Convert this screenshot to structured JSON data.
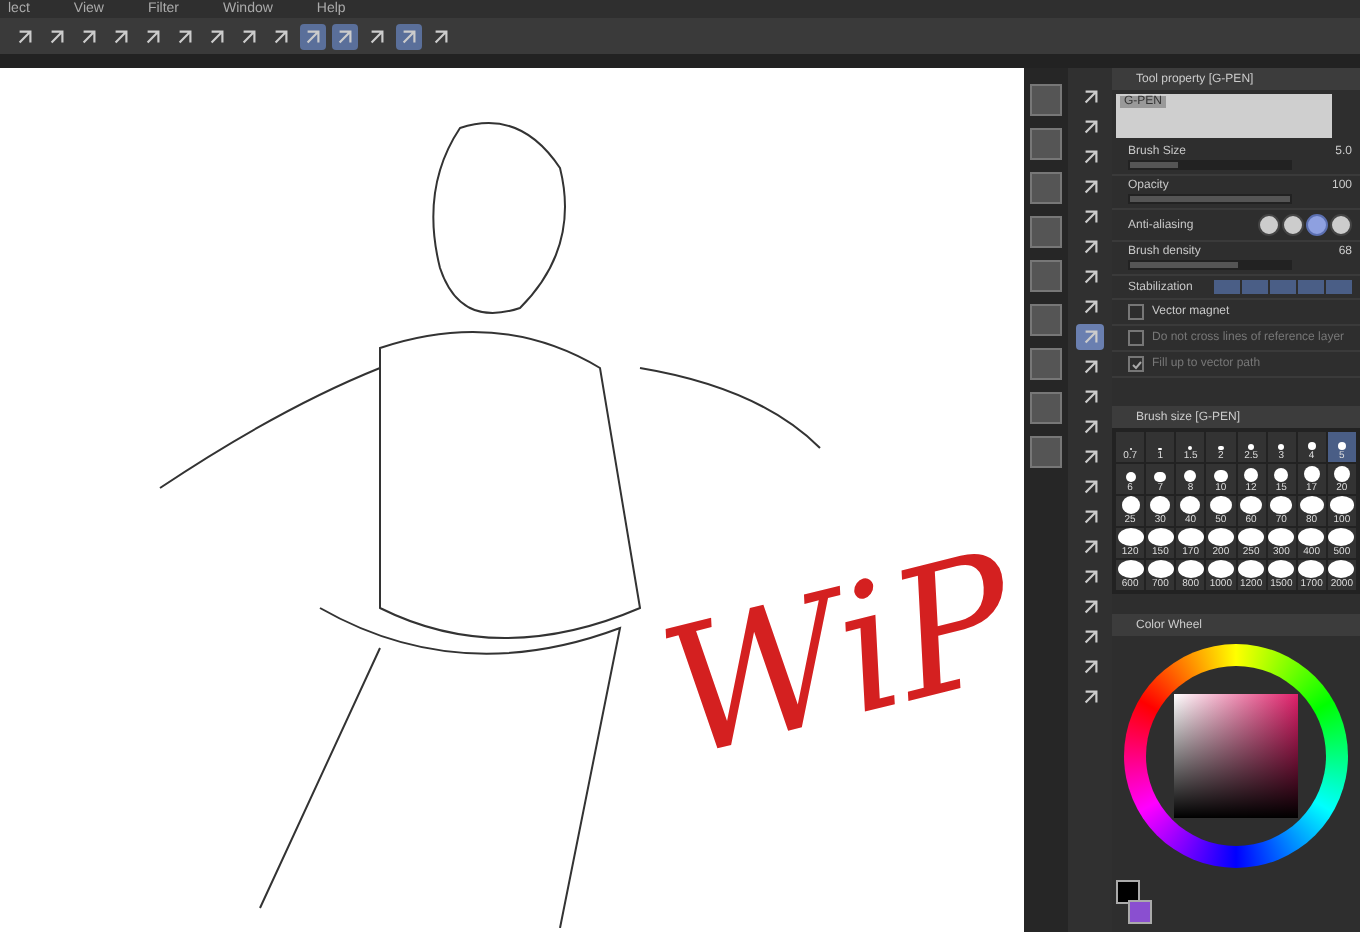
{
  "menu": [
    "lect",
    "View",
    "Filter",
    "Window",
    "Help"
  ],
  "toolbar": [
    {
      "selected": false
    },
    {
      "selected": false
    },
    {
      "selected": false
    },
    {
      "selected": false
    },
    {
      "selected": false
    },
    {
      "selected": false
    },
    {
      "selected": false
    },
    {
      "selected": false
    },
    {
      "selected": false
    },
    {
      "selected": true
    },
    {
      "selected": true
    },
    {
      "selected": false
    },
    {
      "selected": true
    },
    {
      "selected": false
    }
  ],
  "canvas": {
    "overlay_text": "WiP"
  },
  "tools": [
    {
      "selected": false
    },
    {
      "selected": false
    },
    {
      "selected": false
    },
    {
      "selected": false
    },
    {
      "selected": false
    },
    {
      "selected": false
    },
    {
      "selected": false
    },
    {
      "selected": false
    },
    {
      "selected": true
    },
    {
      "selected": false
    },
    {
      "selected": false
    },
    {
      "selected": false
    },
    {
      "selected": false
    },
    {
      "selected": false
    },
    {
      "selected": false
    },
    {
      "selected": false
    },
    {
      "selected": false
    },
    {
      "selected": false
    },
    {
      "selected": false
    },
    {
      "selected": false
    },
    {
      "selected": false
    }
  ],
  "tool_property": {
    "title": "Tool property [G-PEN]",
    "preview_label": "G-PEN",
    "rows": [
      {
        "kind": "slider",
        "label": "Brush Size",
        "value": "5.0",
        "level": 0.3
      },
      {
        "kind": "slider",
        "label": "Opacity",
        "value": "100",
        "level": 1
      },
      {
        "kind": "options",
        "label": "Anti-aliasing",
        "options": [
          {
            "selected": false
          },
          {
            "selected": false
          },
          {
            "selected": true
          },
          {
            "selected": false
          }
        ]
      },
      {
        "kind": "slider",
        "label": "Brush density",
        "value": "68",
        "level": 0.68
      },
      {
        "kind": "segments",
        "label": "Stabilization"
      },
      {
        "kind": "checkbox",
        "label": "Vector magnet",
        "checked": false,
        "disabled": false
      },
      {
        "kind": "checkbox",
        "label": "Do not cross lines of reference layer",
        "checked": false,
        "disabled": true
      },
      {
        "kind": "checkbox",
        "label": "Fill up to vector path",
        "checked": true,
        "disabled": true
      }
    ]
  },
  "brush_size": {
    "title": "Brush size [G-PEN]",
    "sizes": [
      {
        "label": "0.7",
        "selected": false
      },
      {
        "label": "1",
        "selected": false
      },
      {
        "label": "1.5",
        "selected": false
      },
      {
        "label": "2",
        "selected": false
      },
      {
        "label": "2.5",
        "selected": false
      },
      {
        "label": "3",
        "selected": false
      },
      {
        "label": "4",
        "selected": false
      },
      {
        "label": "5",
        "selected": true
      },
      {
        "label": "6",
        "selected": false
      },
      {
        "label": "7",
        "selected": false
      },
      {
        "label": "8",
        "selected": false
      },
      {
        "label": "10",
        "selected": false
      },
      {
        "label": "12",
        "selected": false
      },
      {
        "label": "15",
        "selected": false
      },
      {
        "label": "17",
        "selected": false
      },
      {
        "label": "20",
        "selected": false
      },
      {
        "label": "25",
        "selected": false
      },
      {
        "label": "30",
        "selected": false
      },
      {
        "label": "40",
        "selected": false
      },
      {
        "label": "50",
        "selected": false
      },
      {
        "label": "60",
        "selected": false
      },
      {
        "label": "70",
        "selected": false
      },
      {
        "label": "80",
        "selected": false
      },
      {
        "label": "100",
        "selected": false
      },
      {
        "label": "120",
        "selected": false
      },
      {
        "label": "150",
        "selected": false
      },
      {
        "label": "170",
        "selected": false
      },
      {
        "label": "200",
        "selected": false
      },
      {
        "label": "250",
        "selected": false
      },
      {
        "label": "300",
        "selected": false
      },
      {
        "label": "400",
        "selected": false
      },
      {
        "label": "500",
        "selected": false
      },
      {
        "label": "600",
        "selected": false
      },
      {
        "label": "700",
        "selected": false
      },
      {
        "label": "800",
        "selected": false
      },
      {
        "label": "1000",
        "selected": false
      },
      {
        "label": "1200",
        "selected": false
      },
      {
        "label": "1500",
        "selected": false
      },
      {
        "label": "1700",
        "selected": false
      },
      {
        "label": "2000",
        "selected": false
      }
    ]
  },
  "color_wheel": {
    "title": "Color Wheel"
  }
}
